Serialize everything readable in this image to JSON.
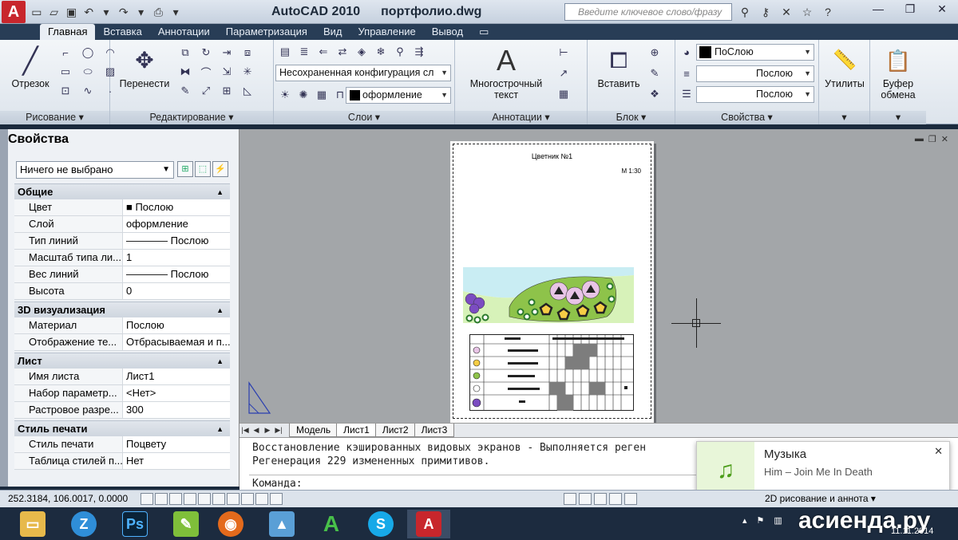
{
  "window": {
    "app_name": "AutoCAD 2010",
    "file_name": "портфолио.dwg",
    "search_placeholder": "Введите ключевое слово/фразу"
  },
  "ribbon": {
    "tabs": [
      "Главная",
      "Вставка",
      "Аннотации",
      "Параметризация",
      "Вид",
      "Управление",
      "Вывод"
    ],
    "active_tab": "Главная",
    "panels": {
      "draw": {
        "title": "Рисование",
        "big_button": "Отрезок"
      },
      "modify": {
        "title": "Редактирование",
        "big_button": "Перенести"
      },
      "layers": {
        "title": "Слои",
        "layer_state": "Несохраненная конфигурация сл",
        "current_layer": "оформление"
      },
      "annotation": {
        "title": "Аннотации",
        "big_button_line1": "Многострочный",
        "big_button_line2": "текст"
      },
      "block": {
        "title": "Блок",
        "big_button": "Вставить"
      },
      "properties": {
        "title": "Свойства",
        "color": "ПоСлою",
        "linetype": "Послою",
        "lineweight": "Послою"
      },
      "utilities": {
        "big_button": "Утилиты"
      },
      "clipboard": {
        "big_button_line1": "Буфер",
        "big_button_line2": "обмена"
      }
    }
  },
  "palette": {
    "title": "Свойства",
    "selection": "Ничего не выбрано",
    "sections": [
      {
        "name": "Общие",
        "rows": [
          {
            "k": "Цвет",
            "v": "■ Послою"
          },
          {
            "k": "Слой",
            "v": "оформление"
          },
          {
            "k": "Тип линий",
            "v": "———— Послою"
          },
          {
            "k": "Масштаб типа ли...",
            "v": "1"
          },
          {
            "k": "Вес линий",
            "v": "———— Послою"
          },
          {
            "k": "Высота",
            "v": "0"
          }
        ]
      },
      {
        "name": "3D визуализация",
        "rows": [
          {
            "k": "Материал",
            "v": "Послою"
          },
          {
            "k": "Отображение те...",
            "v": "Отбрасываемая и п..."
          }
        ]
      },
      {
        "name": "Лист",
        "rows": [
          {
            "k": "Имя листа",
            "v": "Лист1"
          },
          {
            "k": "Набор параметр...",
            "v": "<Нет>"
          },
          {
            "k": "Растровое разре...",
            "v": "300"
          }
        ]
      },
      {
        "name": "Стиль печати",
        "rows": [
          {
            "k": "Стиль печати",
            "v": "Поцвету"
          },
          {
            "k": "Таблица стилей п...",
            "v": "Нет"
          }
        ]
      }
    ]
  },
  "sheet": {
    "title": "Цветник №1",
    "scale": "М 1:30"
  },
  "layout_tabs": [
    "Модель",
    "Лист1",
    "Лист2",
    "Лист3"
  ],
  "active_layout": "Лист1",
  "command": {
    "line1": "Восстановление кэшированных видовых экранов - Выполняется реген",
    "line2": "Регенерация 229 измененных примитивов.",
    "prompt": "Команда:"
  },
  "notification": {
    "title": "Музыка",
    "text": "Him – Join Me In Death"
  },
  "status": {
    "coords": "252.3184, 106.0017, 0.0000",
    "workspace": "2D рисование и аннота ▾"
  },
  "taskbar": {
    "watermark": "асиенда.ру",
    "date": "11.11.2014"
  },
  "colors": {
    "accent": "#c8262c",
    "titlebar": "#283d56",
    "canvas": "#a3a6a9"
  }
}
